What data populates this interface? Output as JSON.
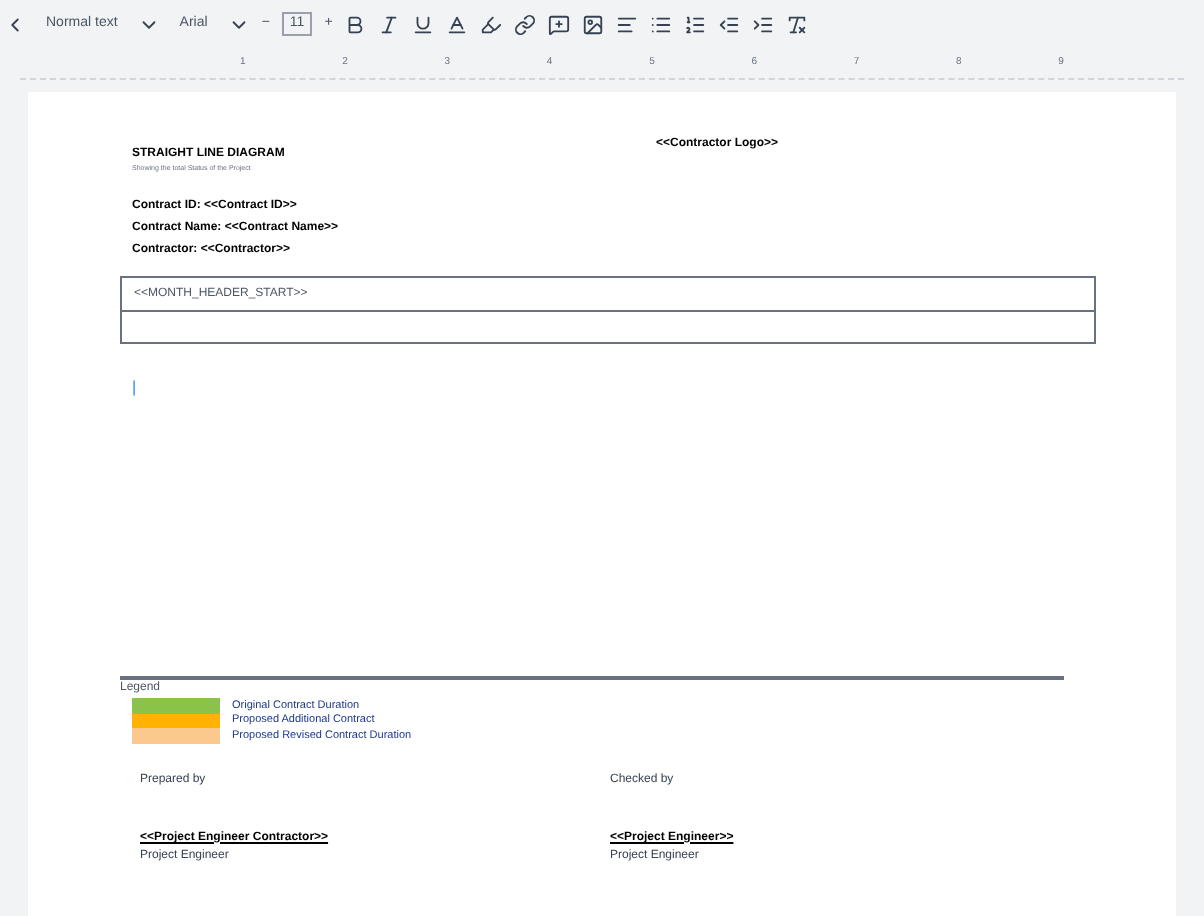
{
  "toolbar": {
    "style": "Normal text",
    "font": "Arial",
    "decrease": "−",
    "size": "11",
    "increase": "+"
  },
  "ruler": {
    "marks": [
      "1",
      "2",
      "3",
      "4",
      "5",
      "6",
      "7",
      "8",
      "9"
    ]
  },
  "document": {
    "title": "STRAIGHT LINE DIAGRAM",
    "subtitle": "Showing the total Status of the Project",
    "logo": "<<Contractor Logo>>",
    "fields": [
      {
        "label": "Contract ID:",
        "value": "<<Contract ID>>"
      },
      {
        "label": "Contract Name:",
        "value": "<<Contract Name>>"
      },
      {
        "label": "Contractor:",
        "value": "<<Contractor>>"
      }
    ],
    "table": {
      "rows": [
        "<<MONTH_HEADER_START>>",
        ""
      ]
    },
    "cursor": "|",
    "legend": {
      "title": "Legend",
      "items": [
        {
          "label": "Original Contract Duration",
          "color": "#8bc34a"
        },
        {
          "label": "Proposed Additional Contract",
          "color": "#ffb300"
        },
        {
          "label": "Proposed Revised Contract Duration",
          "color": "#fbc98d"
        }
      ]
    },
    "signatures": [
      {
        "caption": "Prepared by",
        "name": "<<Project Engineer Contractor>>",
        "role": "Project Engineer"
      },
      {
        "caption": "Checked by",
        "name": "<<Project Engineer>>",
        "role": "Project Engineer"
      }
    ]
  }
}
